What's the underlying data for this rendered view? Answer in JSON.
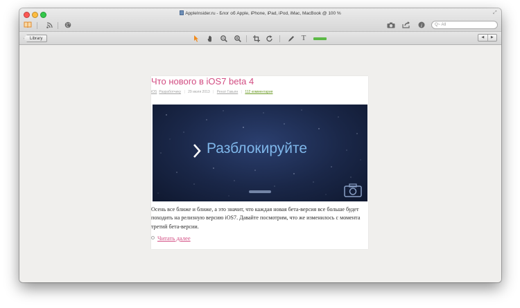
{
  "window": {
    "title": "AppleInsider.ru - Блог об Apple, iPhone, iPad, iPod, iMac, MacBook @ 100 %"
  },
  "toolbar": {
    "search_placeholder": "Q~ All",
    "icons": [
      "library-icon",
      "rss-icon",
      "globe-icon",
      "camera-icon",
      "share-icon",
      "info-icon"
    ]
  },
  "toolbar2": {
    "library_label": "Library",
    "tools": [
      "pointer-icon",
      "hand-icon",
      "zoom-out-icon",
      "zoom-in-icon",
      "crop-icon",
      "rotate-icon",
      "pen-icon",
      "text-icon",
      "highlight-icon"
    ],
    "highlight_color": "#5cb946",
    "nav_back": "◀",
    "nav_forward": "▶"
  },
  "article": {
    "title": "Что нового в iOS7 beta 4",
    "meta": {
      "category": "iOS",
      "category2": "Разработчику",
      "date": "29 июля 2013",
      "author": "Ренат Гакьян",
      "comments": "112 комментария"
    },
    "hero_text": "Разблокируйте",
    "body": "Осень все ближе и ближе, а это значит, что каждая новая бета-версия все больше будет походить на релизную версию iOS7. Давайте посмотрим, что же изменилось с момента третий бета-версии.",
    "read_more": "Читать далее"
  },
  "colors": {
    "accent": "#d24c82",
    "comments": "#6a9a24"
  }
}
